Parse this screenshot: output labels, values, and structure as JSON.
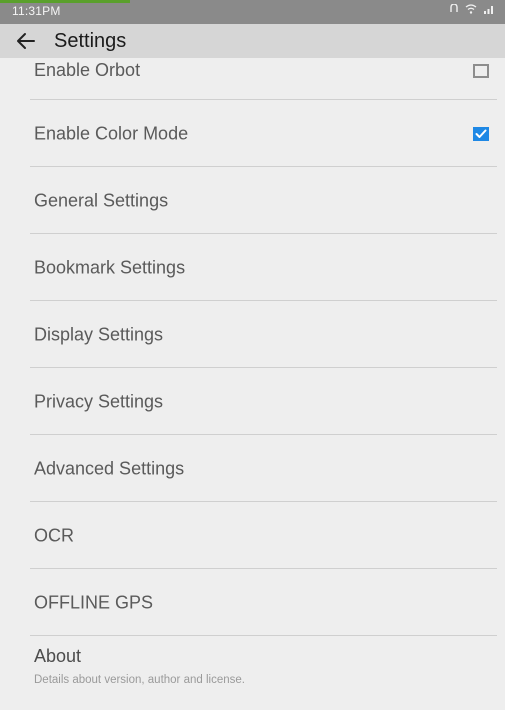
{
  "status_bar": {
    "time": "11:31PM",
    "icons": [
      "nfc-icon",
      "wifi-icon",
      "signal-icon"
    ]
  },
  "app_bar": {
    "back_icon": "arrow-left-icon",
    "title": "Settings"
  },
  "items": [
    {
      "label": "Enable Orbot",
      "checkbox": "unchecked"
    },
    {
      "label": "Enable Color Mode",
      "checkbox": "checked"
    },
    {
      "label": "General Settings"
    },
    {
      "label": "Bookmark Settings"
    },
    {
      "label": "Display Settings"
    },
    {
      "label": "Privacy Settings"
    },
    {
      "label": "Advanced Settings"
    },
    {
      "label": "OCR"
    },
    {
      "label": "OFFLINE GPS"
    }
  ],
  "about": {
    "title": "About",
    "subtitle": "Details about version, author and license."
  },
  "colors": {
    "accent": "#1e88e5",
    "status_bar": "#8a8a8a",
    "app_bar": "#d6d6d6",
    "background": "#eeeeee"
  }
}
